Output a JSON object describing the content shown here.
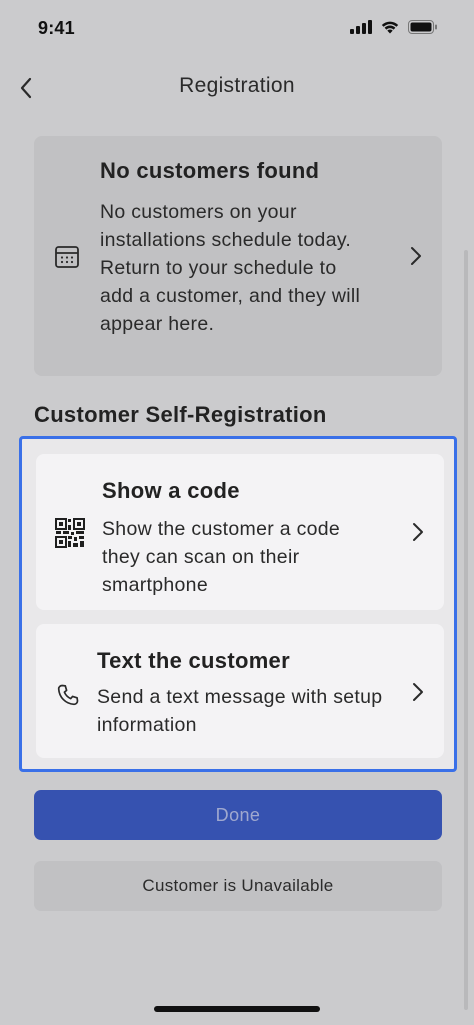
{
  "status_bar": {
    "time": "9:41"
  },
  "header": {
    "title": "Registration",
    "back_icon": "chevron-left-icon"
  },
  "no_customers_card": {
    "icon": "calendar-icon",
    "title": "No customers found",
    "body": "No customers on your installations schedule today. Return to your schedule to add a customer, and they will appear here."
  },
  "self_registration": {
    "section_title": "Customer Self-Registration",
    "options": [
      {
        "icon": "qr-code-icon",
        "title": "Show a code",
        "body": "Show the customer a code they can scan on their smartphone"
      },
      {
        "icon": "phone-icon",
        "title": "Text the customer",
        "body": "Send a text message with setup information"
      }
    ]
  },
  "actions": {
    "done_label": "Done",
    "unavailable_label": "Customer is Unavailable"
  },
  "colors": {
    "background": "#cbcbcd",
    "primary": "#3652b0",
    "highlight_border": "#3a70e8"
  }
}
